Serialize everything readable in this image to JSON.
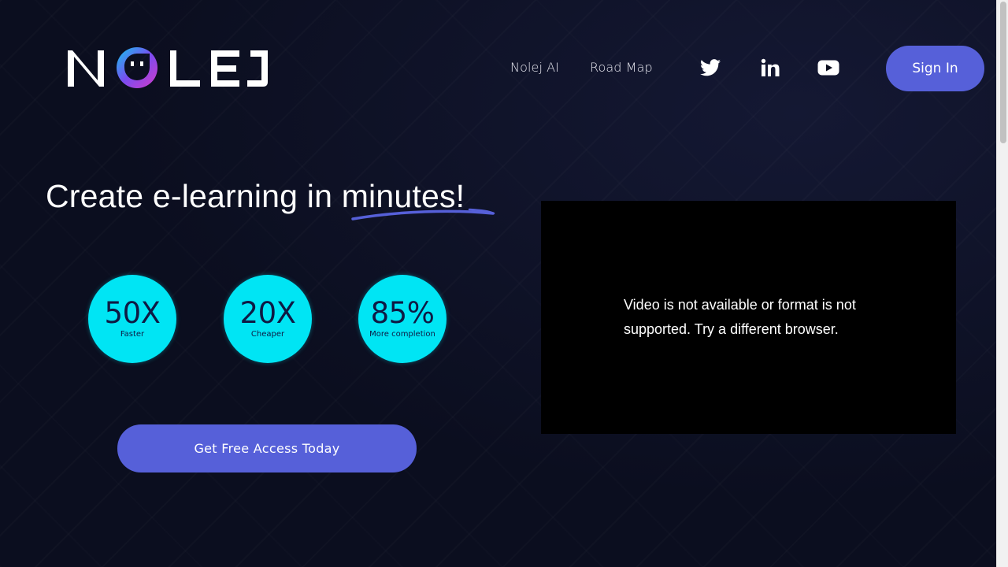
{
  "header": {
    "logo_text": "NOLEJ",
    "nav": [
      {
        "label": "Nolej AI"
      },
      {
        "label": "Road Map"
      }
    ],
    "social": [
      {
        "icon": "twitter-icon"
      },
      {
        "icon": "linkedin-icon"
      },
      {
        "icon": "youtube-icon"
      }
    ],
    "signin_label": "Sign In"
  },
  "hero": {
    "headline_prefix": "Create e-learning in ",
    "headline_highlight": "minutes!",
    "stats": [
      {
        "value": "50X",
        "label": "Faster"
      },
      {
        "value": "20X",
        "label": "Cheaper"
      },
      {
        "value": "85%",
        "label": "More completion"
      }
    ],
    "cta_label": "Get Free Access Today"
  },
  "video": {
    "message": "Video is not available or format is not supported. Try a different browser."
  },
  "colors": {
    "background": "#0b0e1f",
    "accent": "#5660d9",
    "stat_circle": "#00e5f4",
    "stat_text": "#0e1a44"
  }
}
